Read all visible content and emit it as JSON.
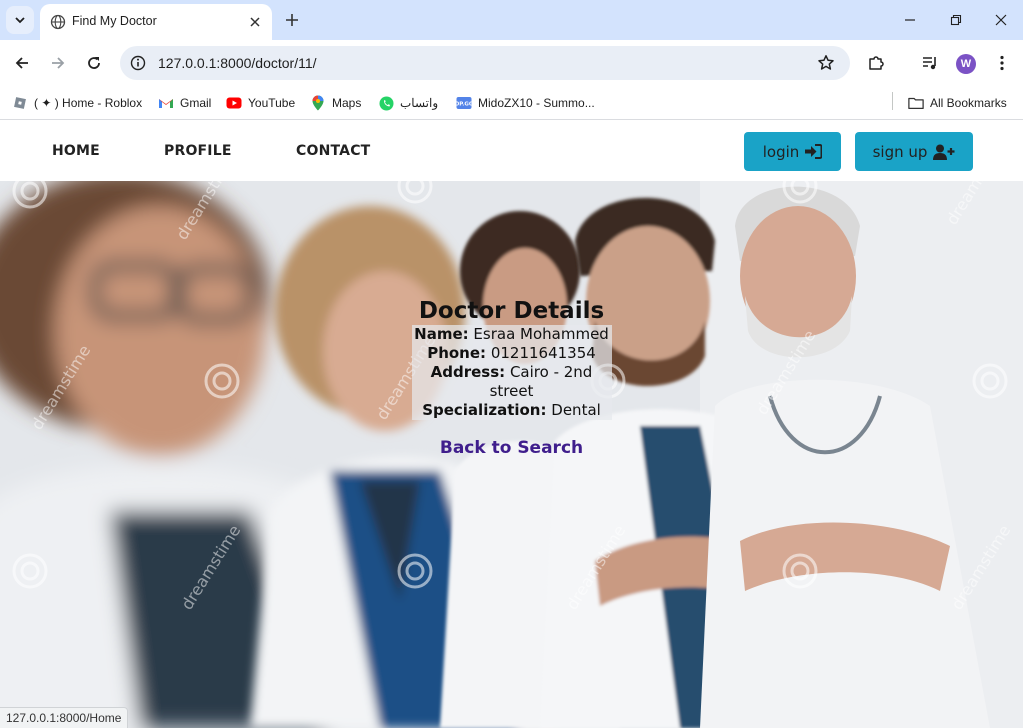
{
  "browser": {
    "tab_title": "Find My Doctor",
    "url": "127.0.0.1:8000/doctor/11/",
    "profile_initial": "W",
    "status_url": "127.0.0.1:8000/Home",
    "bookmarks": [
      {
        "label": "( ✦ ) Home - Roblox",
        "icon": "roblox-icon"
      },
      {
        "label": "Gmail",
        "icon": "gmail-icon"
      },
      {
        "label": "YouTube",
        "icon": "youtube-icon"
      },
      {
        "label": "Maps",
        "icon": "maps-icon"
      },
      {
        "label": "واتساب",
        "icon": "whatsapp-icon"
      },
      {
        "label": "MidoZX10 - Summo...",
        "icon": "op-gg-icon"
      }
    ],
    "all_bookmarks": "All Bookmarks"
  },
  "site": {
    "nav": {
      "home": "HOME",
      "profile": "PROFILE",
      "contact": "CONTACT",
      "login": "login",
      "signup": "sign up"
    },
    "details": {
      "title": "Doctor Details",
      "name_label": "Name:",
      "name_value": "Esraa Mohammed",
      "phone_label": "Phone:",
      "phone_value": "01211641354",
      "address_label": "Address:",
      "address_value": "Cairo - 2nd street",
      "specialization_label": "Specialization:",
      "specialization_value": "Dental",
      "back_link": "Back to Search"
    },
    "watermark": "dreamstime",
    "accent_color": "#1aa3c7",
    "link_color": "#3f1e8c"
  }
}
